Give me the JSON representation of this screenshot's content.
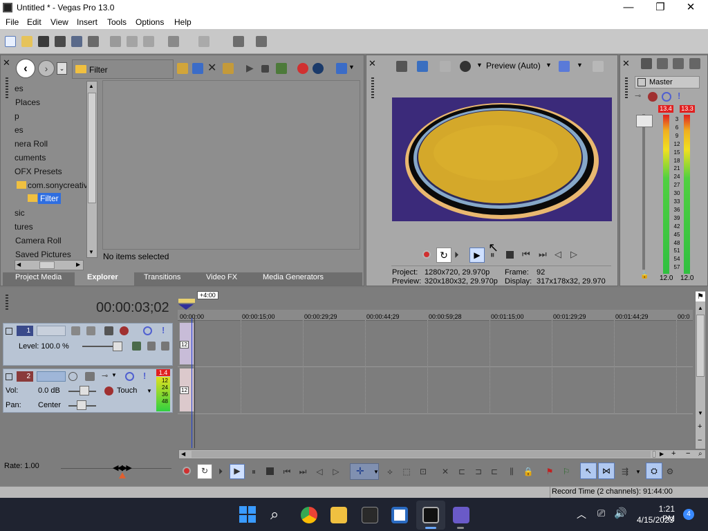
{
  "window": {
    "title": "Untitled * - Vegas Pro 13.0",
    "minimize": "—",
    "maximize": "❐",
    "close": "✕"
  },
  "menu": [
    "File",
    "Edit",
    "View",
    "Insert",
    "Tools",
    "Options",
    "Help"
  ],
  "explorer": {
    "path": "Filter",
    "tree": [
      "es",
      "Places",
      "p",
      "es",
      "nera Roll",
      "cuments",
      "OFX Presets",
      "com.sonycreativ",
      "Filter",
      "sic",
      "tures",
      "Camera Roll",
      "Saved Pictures"
    ],
    "selected_index": 8,
    "status": "No items selected",
    "tabs": [
      "Project Media",
      "Explorer",
      "Transitions",
      "Video FX",
      "Media Generators"
    ],
    "active_tab": 1
  },
  "preview": {
    "mode": "Preview (Auto)",
    "project_label": "Project:",
    "project_value": "1280x720, 29.970p",
    "preview_label": "Preview:",
    "preview_value": "320x180x32, 29.970p",
    "frame_label": "Frame:",
    "frame_value": "92",
    "display_label": "Display:",
    "display_value": "317x178x32, 29.970"
  },
  "master": {
    "label": "Master",
    "peak_l": "13.4",
    "peak_r": "13.3",
    "scale": [
      "3",
      "6",
      "9",
      "12",
      "15",
      "18",
      "21",
      "24",
      "27",
      "30",
      "33",
      "36",
      "39",
      "42",
      "45",
      "48",
      "51",
      "54",
      "57"
    ],
    "foot_l": "12.0",
    "foot_r": "12.0"
  },
  "timeline": {
    "timecode": "00:00:03;02",
    "offset": "+4:00",
    "ruler": [
      "00:00:00",
      "00:00:15;00",
      "00:00:29;29",
      "00:00:44;29",
      "00:00:59;28",
      "00:01:15;00",
      "00:01:29;29",
      "00:01:44;29",
      "00:0"
    ],
    "track1": {
      "number": "1",
      "level": "Level: 100.0 %",
      "clip_label": "12"
    },
    "track2": {
      "number": "2",
      "vol_label": "Vol:",
      "vol_value": "0.0 dB",
      "pan_label": "Pan:",
      "pan_value": "Center",
      "mode": "Touch",
      "peak": "1.4",
      "meter": [
        "12",
        "24",
        "36",
        "48"
      ],
      "clip_label": "12"
    },
    "rate": "Rate: 1.00"
  },
  "status": {
    "record_time": "Record Time (2 channels): 91:44:00"
  },
  "taskbar": {
    "time": "1:21 PM",
    "date": "4/15/2023",
    "badge": "4"
  },
  "colors": {
    "accent": "#2f6ee0",
    "titlebar": "#ffffff",
    "panel": "#8c8c8c",
    "timeline_bg": "#7d7d7d",
    "taskbar": "#1f2330",
    "peak_red": "#e02020"
  }
}
